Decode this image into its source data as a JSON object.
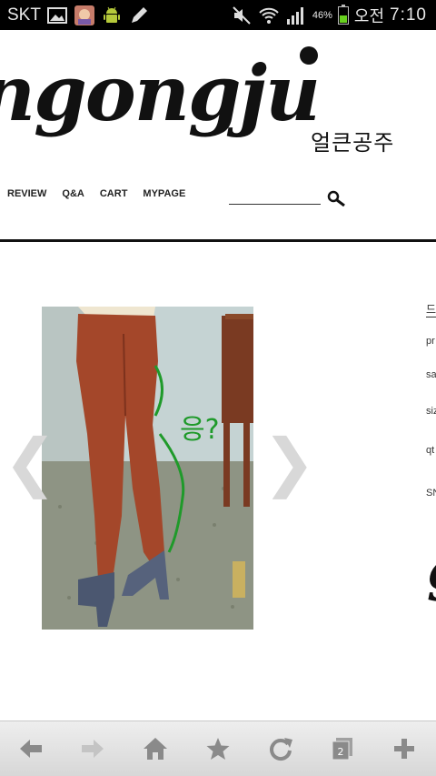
{
  "status_bar": {
    "carrier": "SKT",
    "battery_percent": "46%",
    "ampm": "오전",
    "time": "7:10",
    "battery_level": 0.46,
    "icons": [
      "gallery-icon",
      "app-thumbnail-icon",
      "android-icon",
      "pencil-icon",
      "mute-icon",
      "wifi-icon",
      "signal-icon",
      "battery-icon"
    ]
  },
  "site": {
    "logo": "ngongju",
    "logo_subtitle": "얼큰공주",
    "nav": [
      "REVIEW",
      "Q&A",
      "CART",
      "MYPAGE"
    ],
    "search": {
      "value": "",
      "placeholder": ""
    }
  },
  "product": {
    "image_icon": "product-photo",
    "prev_arrow": "❮",
    "next_arrow": "❯",
    "annotation": "응?",
    "info_labels": [
      "드",
      "pr",
      "sa",
      "siz",
      "qt",
      "SN"
    ],
    "cut_glyph": "g"
  },
  "toolbar": {
    "buttons": [
      "back-icon",
      "forward-icon",
      "home-icon",
      "bookmark-star-icon",
      "refresh-icon",
      "tabs-icon",
      "add-icon"
    ],
    "tabs_count": "2"
  },
  "colors": {
    "status_bar_bg": "#000000",
    "battery_green": "#67d11e",
    "annotation_green": "#1f9a2a",
    "pants_rust": "#a4472a",
    "toolbar_bg": "#e3e3e3"
  }
}
